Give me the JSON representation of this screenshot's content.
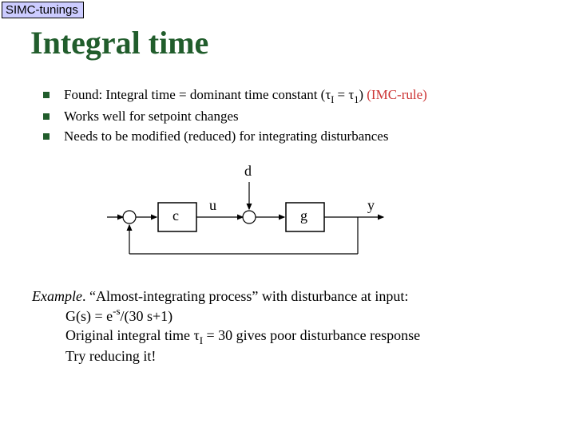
{
  "tag": "SIMC-tunings",
  "title": "Integral time",
  "bullets": [
    {
      "prefix": "Found: Integral time = dominant time constant (",
      "tau": "τ",
      "subI": "I",
      "eq": " = ",
      "tau2": "τ",
      "sub1": "1",
      "close": ") ",
      "red": "(IMC-rule)"
    },
    {
      "text": "Works well for setpoint changes"
    },
    {
      "text": "Needs to be modified (reduced) for integrating disturbances"
    }
  ],
  "diagram": {
    "d": "d",
    "u": "u",
    "c": "c",
    "g": "g",
    "y": "y"
  },
  "example": {
    "lead": "Example",
    "after_lead": ". “Almost-integrating process” with disturbance at input:",
    "line2a": "G(s) = e",
    "line2sup": "-s",
    "line2b": "/(30 s+1)",
    "line3a": "Original integral time ",
    "line3tau": "τ",
    "line3sub": "I",
    "line3b": " = 30 gives poor disturbance response",
    "line4": "Try reducing it!"
  }
}
